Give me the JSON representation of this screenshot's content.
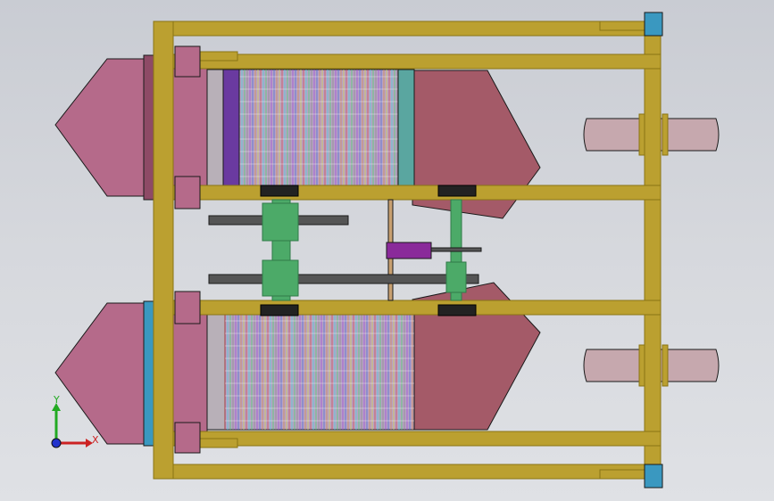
{
  "view": {
    "title": "",
    "background": [
      "#c9ccd3",
      "#dfe1e5"
    ]
  },
  "colors": {
    "frame": "#bba030",
    "frame_dark": "#8a7414",
    "outline": "#1a1a1a",
    "hopper_pink": "#b56a8a",
    "hopper_pink_dark": "#8e4a66",
    "hopper_red": "#a45a68",
    "mount_gray": "#b8b0b8",
    "drum_purple": "#6a3aa0",
    "drum_teal": "#5aa6a0",
    "shaft_green": "#4caa68",
    "shaft_green_dark": "#2f7a48",
    "motor_purple": "#8a2a9a",
    "belt_gray": "#555555",
    "rod_tan": "#c8a070",
    "bracket_blue": "#3a98c0",
    "tie_rod": "#c6a8ae"
  },
  "triad": {
    "y_label": "Y",
    "x_label": "X",
    "icon": "coordinate-triad-icon"
  }
}
